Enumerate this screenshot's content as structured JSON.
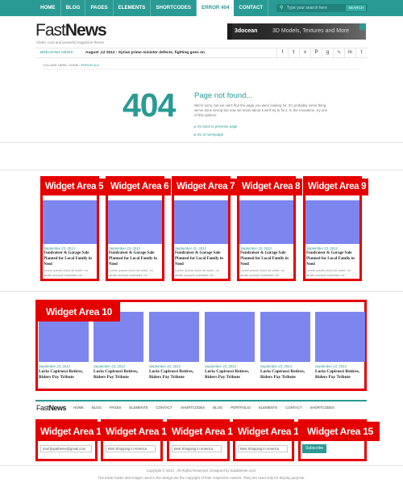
{
  "nav": {
    "items": [
      "HOME",
      "BLOG",
      "PAGES",
      "ELEMENTS",
      "SHORTCODES",
      "ERROR 404",
      "CONTACT"
    ],
    "active": "ERROR 404"
  },
  "search": {
    "placeholder": "Type your search here",
    "button": "SEARCH"
  },
  "brand": {
    "logo_light": "Fast",
    "logo_bold": "News",
    "tagline": "Clean, cool  and  powerful  magazine theme"
  },
  "ad": {
    "brand": "3docean",
    "text": "3D Models, Textures and More"
  },
  "ticker": {
    "label": "BREAKING NEWS",
    "text": "August ,12 2012 : Syrian prime minister defects, fighting goes on"
  },
  "social_icons": [
    "facebook-icon",
    "twitter-icon",
    "vimeo-icon",
    "pinterest-icon",
    "google-plus-icon",
    "rss-icon",
    "linkedin-icon",
    "tumblr-icon"
  ],
  "breadcrumb": {
    "prefix": "YOU ARE HERE: HOME / ",
    "current": "ERROR 404"
  },
  "error": {
    "code": "404",
    "title": "Page not found...",
    "body": "We're sorry, but we can't find the page you were looking for. It's probably some thing we've done wrong but now we know about it we'll try to fix it. In the meantime, try one of this options:",
    "links": [
      "Go back to previous page",
      "Go to homepage"
    ]
  },
  "widgets_row": [
    {
      "label": "Widget Area 5",
      "date": "September 23, 2013",
      "title": "Fundraiser & Garage Sale Planned for Local Family in Need",
      "text": "Lorem ipsum dolor sit amet, eu alrate suscipit suavitate vix."
    },
    {
      "label": "Widget Area 6",
      "date": "September 23, 2013",
      "title": "Fundraiser & Garage Sale Planned for Local Family in Need",
      "text": "Lorem ipsum dolor sit amet, eu alrate suscipit suavitate vix."
    },
    {
      "label": "Widget Area 7",
      "date": "September 22, 2013",
      "title": "Fundraiser & Garage Sale Planned for Local Family in Need",
      "text": "Lorem ipsum dolor sit amet, eu alrate suscipit suavitate vix."
    },
    {
      "label": "Widget Area 8",
      "date": "September 23, 2013",
      "title": "Fundraiser & Garage Sale Planned for Local Family in Need",
      "text": "Lorem ipsum dolor sit amet, eu alrate suscipit suavitate vix."
    },
    {
      "label": "Widget Area 9",
      "date": "September 23, 2013",
      "title": "Fundraiser & Garage Sale Planned for Local Family in Need",
      "text": "Lorem ipsum dolor sit amet, eu alrate suscipit suavitate vix."
    }
  ],
  "widget10": {
    "label": "Widget Area 10",
    "items": [
      {
        "date": "September 23, 2013",
        "title": "Loria Capirossi Retires, Riders Pay Tribute"
      },
      {
        "date": "September 23, 2013",
        "title": "Loria Capirossi Retires, Riders Pay Tribute"
      },
      {
        "date": "September 23, 2013",
        "title": "Loria Capirossi Retires, Riders Pay Tribute"
      },
      {
        "date": "September 23, 2013",
        "title": "Loria Capirossi Retires, Riders Pay Tribute"
      },
      {
        "date": "September 23, 2013",
        "title": "Loria Capirossi Retires, Riders Pay Tribute"
      },
      {
        "date": "September 23, 2013",
        "title": "Loria Capirossi Retires, Riders Pay Tribute"
      }
    ]
  },
  "footer_nav": [
    "HOME",
    "BLOG",
    "PAGES",
    "ELEMENTS",
    "CONTACT",
    "SHORTCODES",
    "BLOG",
    "PORTFOLIO",
    "ELEMENTS",
    "CONTACT",
    "SHORTCODES"
  ],
  "footer_widgets": [
    {
      "label": "Widget Area 11",
      "field": "mail [topatheme@gmail.com"
    },
    {
      "label": "Widget Area 12",
      "field": "Best Shopping in America"
    },
    {
      "label": "Widget Area 13",
      "field": "Best Shopping in America"
    },
    {
      "label": "Widget Area 14",
      "field": "Best Shopping in America"
    },
    {
      "label": "Widget Area 15",
      "button": "Subscribe"
    }
  ],
  "copyright": {
    "line1": "Copyright © 2013 . All Rights Reserved. Designed by kopatheme.com.",
    "line2": "The trade marks and images used in the design are the copyright of their respective owners. They are used only for display purpose."
  },
  "colors": {
    "accent": "#2a9a94",
    "widget_red": "#e50000",
    "placeholder_image": "#7d86ef"
  }
}
